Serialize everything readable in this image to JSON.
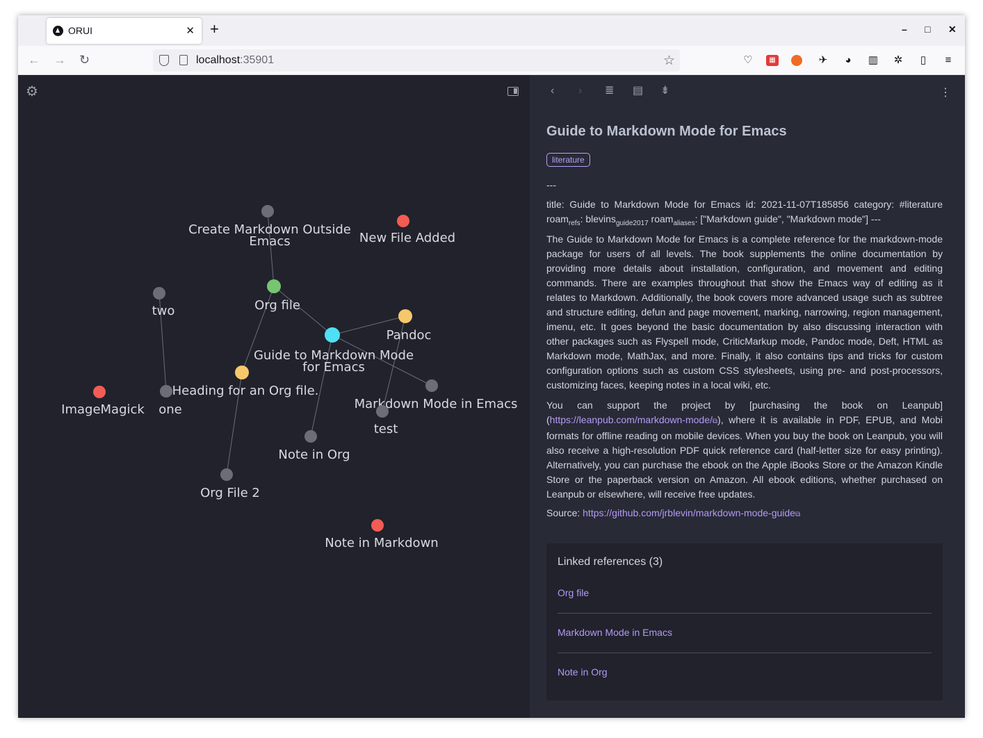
{
  "browser": {
    "tab_title": "ORUI",
    "tab_close": "✕",
    "new_tab": "+",
    "url_host": "localhost",
    "url_port": ":35901",
    "minimize": "–",
    "maximize": "□",
    "close": "✕"
  },
  "graph": {
    "nodes": [
      {
        "id": "create-md",
        "label": "Create Markdown Outside\nEmacs",
        "color": "#6b6e79"
      },
      {
        "id": "new-file",
        "label": "New File Added",
        "color": "#f25c54"
      },
      {
        "id": "two",
        "label": "two",
        "color": "#6b6e79"
      },
      {
        "id": "org-file",
        "label": "Org file",
        "color": "#77c472"
      },
      {
        "id": "pandoc",
        "label": "Pandoc",
        "color": "#f7c86b"
      },
      {
        "id": "guide",
        "label": "Guide to Markdown Mode\nfor Emacs",
        "color": "#4fe0f5"
      },
      {
        "id": "heading",
        "label": "Heading for an Org file.",
        "color": "#f7c86b"
      },
      {
        "id": "one",
        "label": "one",
        "color": "#6b6e79"
      },
      {
        "id": "imagemagick",
        "label": "ImageMagick",
        "color": "#f25c54"
      },
      {
        "id": "md-mode",
        "label": "Markdown Mode in Emacs",
        "color": "#6b6e79"
      },
      {
        "id": "test",
        "label": "test",
        "color": "#6b6e79"
      },
      {
        "id": "note-org",
        "label": "Note in Org",
        "color": "#6b6e79"
      },
      {
        "id": "org-file-2",
        "label": "Org File 2",
        "color": "#6b6e79"
      },
      {
        "id": "note-md",
        "label": "Note in Markdown",
        "color": "#f25c54"
      }
    ],
    "links": [
      [
        "create-md",
        "org-file"
      ],
      [
        "org-file",
        "guide"
      ],
      [
        "org-file",
        "heading"
      ],
      [
        "guide",
        "pandoc"
      ],
      [
        "guide",
        "md-mode"
      ],
      [
        "guide",
        "note-org"
      ],
      [
        "pandoc",
        "test"
      ],
      [
        "two",
        "one"
      ],
      [
        "heading",
        "org-file-2"
      ]
    ]
  },
  "note": {
    "title": "Guide to Markdown Mode for Emacs",
    "tag": "literature",
    "separator": "---",
    "meta_line1": "title: Guide to Markdown Mode for Emacs id: 2021-11-07T185856 category: #literature",
    "meta_roam1": "roam",
    "meta_sub1": "refs",
    "meta_val1": ": blevins",
    "meta_sub2": "guide2017",
    "meta_roam2": " roam",
    "meta_sub3": "aliases",
    "meta_val2": ": [\"Markdown guide\", \"Markdown mode\"] ---",
    "paragraph1": "The Guide to Markdown Mode for Emacs is a complete reference for the markdown-mode package for users of all levels. The book supplements the online documentation by providing more details about installation, configuration, and movement and editing commands. There are examples throughout that show the Emacs way of editing as it relates to Markdown. Additionally, the book covers more advanced usage such as subtree and structure editing, defun and page movement, marking, narrowing, region management, imenu, etc. It goes beyond the basic documentation by also discussing interaction with other packages such as Flyspell mode, CriticMarkup mode, Pandoc mode, Deft, HTML as Markdown mode, MathJax, and more. Finally, it also contains tips and tricks for custom configuration options such as custom CSS stylesheets, using pre- and post-processors, customizing faces, keeping notes in a local wiki, etc.",
    "paragraph2_before": "You can support the project by [purchasing the book on Leanpub](",
    "paragraph2_link": "https://leanpub.com/markdown-mode/",
    "paragraph2_after": "), where it is available in PDF, EPUB, and Mobi formats for offline reading on mobile devices. When you buy the book on Leanpub, you will also receive a high-resolution PDF quick reference card (half-letter size for easy printing). Alternatively, you can purchase the ebook on the Apple iBooks Store or the Amazon Kindle Store or the paperback version on Amazon. All ebook editions, whether purchased on Leanpub or elsewhere, will receive free updates.",
    "source_label": "Source: ",
    "source_link": "https://github.com/jrblevin/markdown-mode-guide"
  },
  "linked_refs": {
    "title": "Linked references (3)",
    "items": [
      "Org file",
      "Markdown Mode in Emacs",
      "Note in Org"
    ]
  },
  "icons": {
    "settings": "settings-icon",
    "sidebar_toggle": "sidebar-toggle-icon",
    "back": "chevron-left-icon",
    "forward": "chevron-right-icon",
    "list": "list-icon",
    "document": "document-icon",
    "collapse": "collapse-icon",
    "more": "more-vertical-icon"
  }
}
